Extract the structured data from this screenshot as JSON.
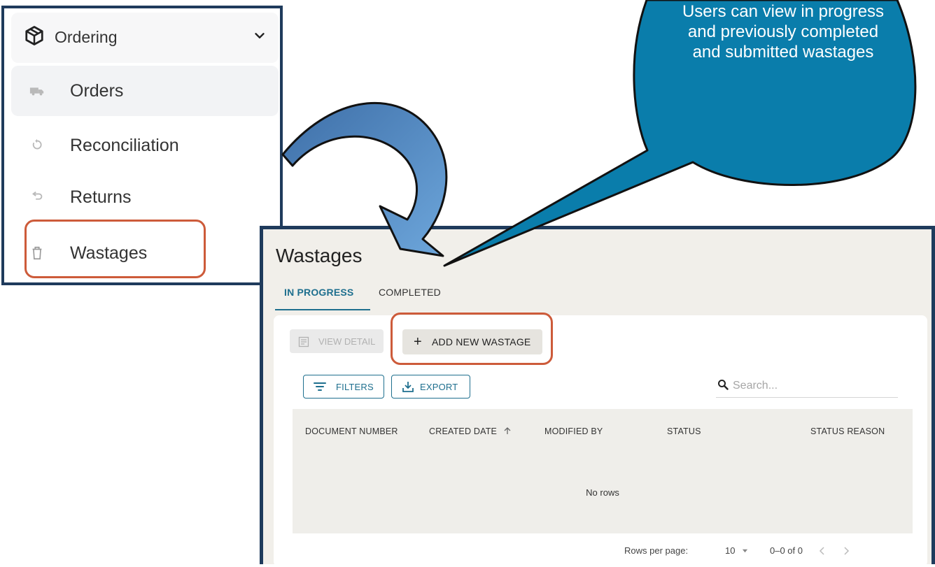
{
  "sidebar": {
    "group_label": "Ordering",
    "items": [
      {
        "label": "Orders",
        "icon": "truck-icon"
      },
      {
        "label": "Reconciliation",
        "icon": "sync-icon"
      },
      {
        "label": "Returns",
        "icon": "return-icon"
      },
      {
        "label": "Wastages",
        "icon": "trash-icon"
      }
    ]
  },
  "callout": {
    "text": "Users can view in progress and previously completed and submitted wastages"
  },
  "main": {
    "title": "Wastages",
    "tabs": [
      {
        "label": "IN PROGRESS",
        "active": true
      },
      {
        "label": "COMPLETED",
        "active": false
      }
    ],
    "toolbar": {
      "view_detail": "VIEW DETAIL",
      "add_new": "ADD NEW WASTAGE",
      "filters": "FILTERS",
      "export": "EXPORT",
      "search_placeholder": "Search..."
    },
    "table": {
      "columns": [
        "DOCUMENT NUMBER",
        "CREATED DATE",
        "MODIFIED BY",
        "STATUS",
        "STATUS REASON"
      ],
      "empty_text": "No rows"
    },
    "pagination": {
      "rows_per_page_label": "Rows per page:",
      "rows_per_page_value": "10",
      "range": "0–0 of 0"
    }
  },
  "colors": {
    "accent": "#1e6f8e",
    "highlight": "#cd5b3a",
    "frame": "#1f3b5c",
    "bubble": "#0a7dab",
    "arrow": "#4f81bd"
  }
}
